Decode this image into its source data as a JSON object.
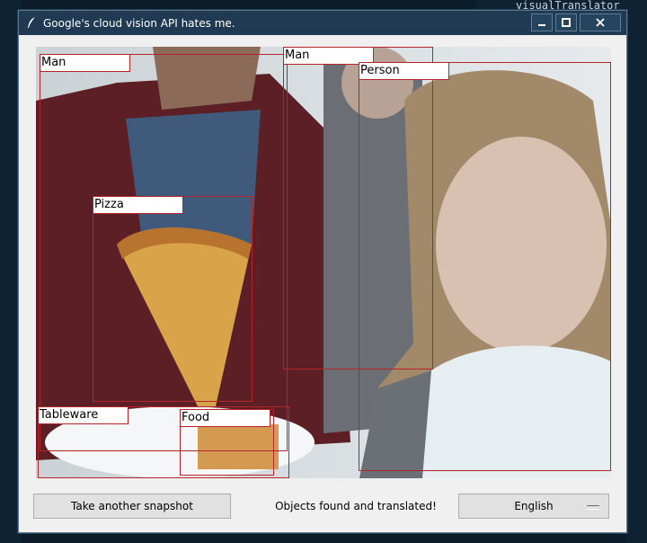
{
  "window": {
    "title": "Google's cloud vision API hates me."
  },
  "detections": [
    {
      "label": "Man"
    },
    {
      "label": "Man"
    },
    {
      "label": "Person"
    },
    {
      "label": "Pizza"
    },
    {
      "label": "Tableware"
    },
    {
      "label": "Food"
    }
  ],
  "footer": {
    "snapshot_button": "Take another snapshot",
    "status_text": "Objects found and translated!",
    "language_selected": "English"
  },
  "icons": {
    "title_icon": "feather-icon",
    "minimize": "minimize-icon",
    "maximize": "maximize-icon",
    "close": "close-icon",
    "dropdown": "dropdown-indicator-icon"
  },
  "colors": {
    "box_outline": "#b3242b",
    "titlebar": "#1f3a52"
  }
}
